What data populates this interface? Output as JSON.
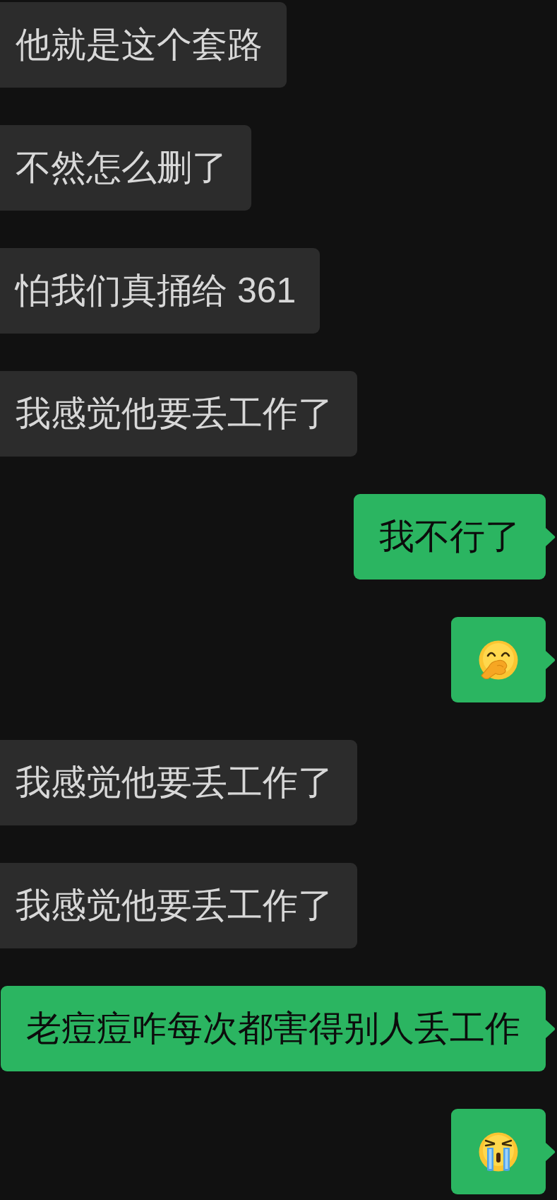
{
  "messages": [
    {
      "outgoing": false,
      "kind": "text",
      "text": "他就是这个套路"
    },
    {
      "outgoing": false,
      "kind": "text",
      "text": "不然怎么删了"
    },
    {
      "outgoing": false,
      "kind": "text",
      "text": "怕我们真捅给 361"
    },
    {
      "outgoing": false,
      "kind": "text",
      "text": "我感觉他要丢工作了"
    },
    {
      "outgoing": true,
      "kind": "text",
      "text": "我不行了"
    },
    {
      "outgoing": true,
      "kind": "giggle"
    },
    {
      "outgoing": false,
      "kind": "text",
      "text": "我感觉他要丢工作了"
    },
    {
      "outgoing": false,
      "kind": "text",
      "text": "我感觉他要丢工作了"
    },
    {
      "outgoing": true,
      "kind": "text",
      "text": "老痘痘咋每次都害得别人丢工作"
    },
    {
      "outgoing": true,
      "kind": "sob"
    }
  ]
}
